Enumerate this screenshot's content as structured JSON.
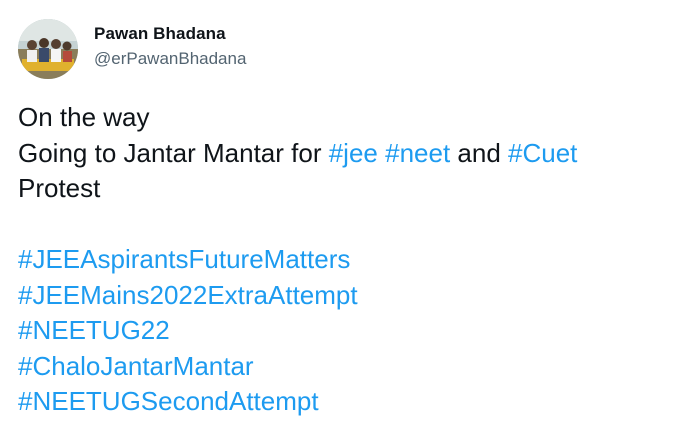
{
  "author": {
    "display_name": "Pawan Bhadana",
    "handle": "@erPawanBhadana"
  },
  "tweet": {
    "line1": "On the way",
    "line2_prefix": "Going to Jantar Mantar for ",
    "tag_jee": "#jee",
    "tag_neet": "#neet",
    "and_text": " and ",
    "tag_cuet": "#Cuet",
    "line3": "Protest",
    "hashtags": [
      "#JEEAspirantsFutureMatters",
      "#JEEMains2022ExtraAttempt",
      "#NEETUG22",
      "#ChaloJantarMantar",
      "#NEETUGSecondAttempt"
    ]
  },
  "colors": {
    "link": "#1d9bf0",
    "text": "#0f1419",
    "secondary": "#536471"
  }
}
